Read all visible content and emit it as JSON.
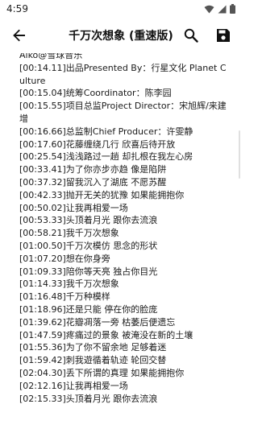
{
  "status_bar": {
    "time": "4:59"
  },
  "app_bar": {
    "title": "千万次想象 (重速版)",
    "icons": [
      "back-arrow-icon",
      "search-icon",
      "save-icon"
    ]
  },
  "editor": {
    "lines": [
      "Aiko@雪球音乐",
      "[00:14.11]出品Presented By：行星文化 Planet Culture",
      "[00:15.04]统筹Coordinator：陈李园",
      "[00:15.55]项目总监Project Director：宋旭辉/来建增",
      "[00:16.66]总监制Chief Producer：许雯静",
      "[00:17.60]花藤缠绕几行 欣喜后待开放",
      "[00:25.54]浅浅路过一趟 却扎根在我左心房",
      "[00:33.41]为了你亦步亦趋 像是陷阱",
      "[00:37.32]留我沉入了湖底 不愿苏醒",
      "[00:42.33]抛开无关的犹豫 如果能拥抱你",
      "[00:50.02]让我再相爱一场",
      "[00:53.33]头顶着月光 跟你去流浪",
      "[00:58.21]我千万次想象",
      "[01:00.50]千万次模仿 思念的形状",
      "[01:07.20]想在你身旁",
      "[01:09.33]陪你等天亮 独占你目光",
      "[01:14.33]我千万次想象",
      "[01:16.48]千万种模样",
      "[01:18.96]还是只能 停在你的脸庞",
      "[01:39.62]花瓣凋落一旁 枯萎后便遗忘",
      "[01:47.59]疼痛过的景象 被淹没在新的土壤",
      "[01:55.36]为了你不留余地 足够着迷",
      "[01:59.42]刺我遊循着轨迹 轮回交替",
      "[02:04.30]丢下所谓的真理 如果能拥抱你",
      "[02:12.16]让我再相爱一场",
      "[02:15.33]头顶着月光 跟你去流浪"
    ]
  }
}
